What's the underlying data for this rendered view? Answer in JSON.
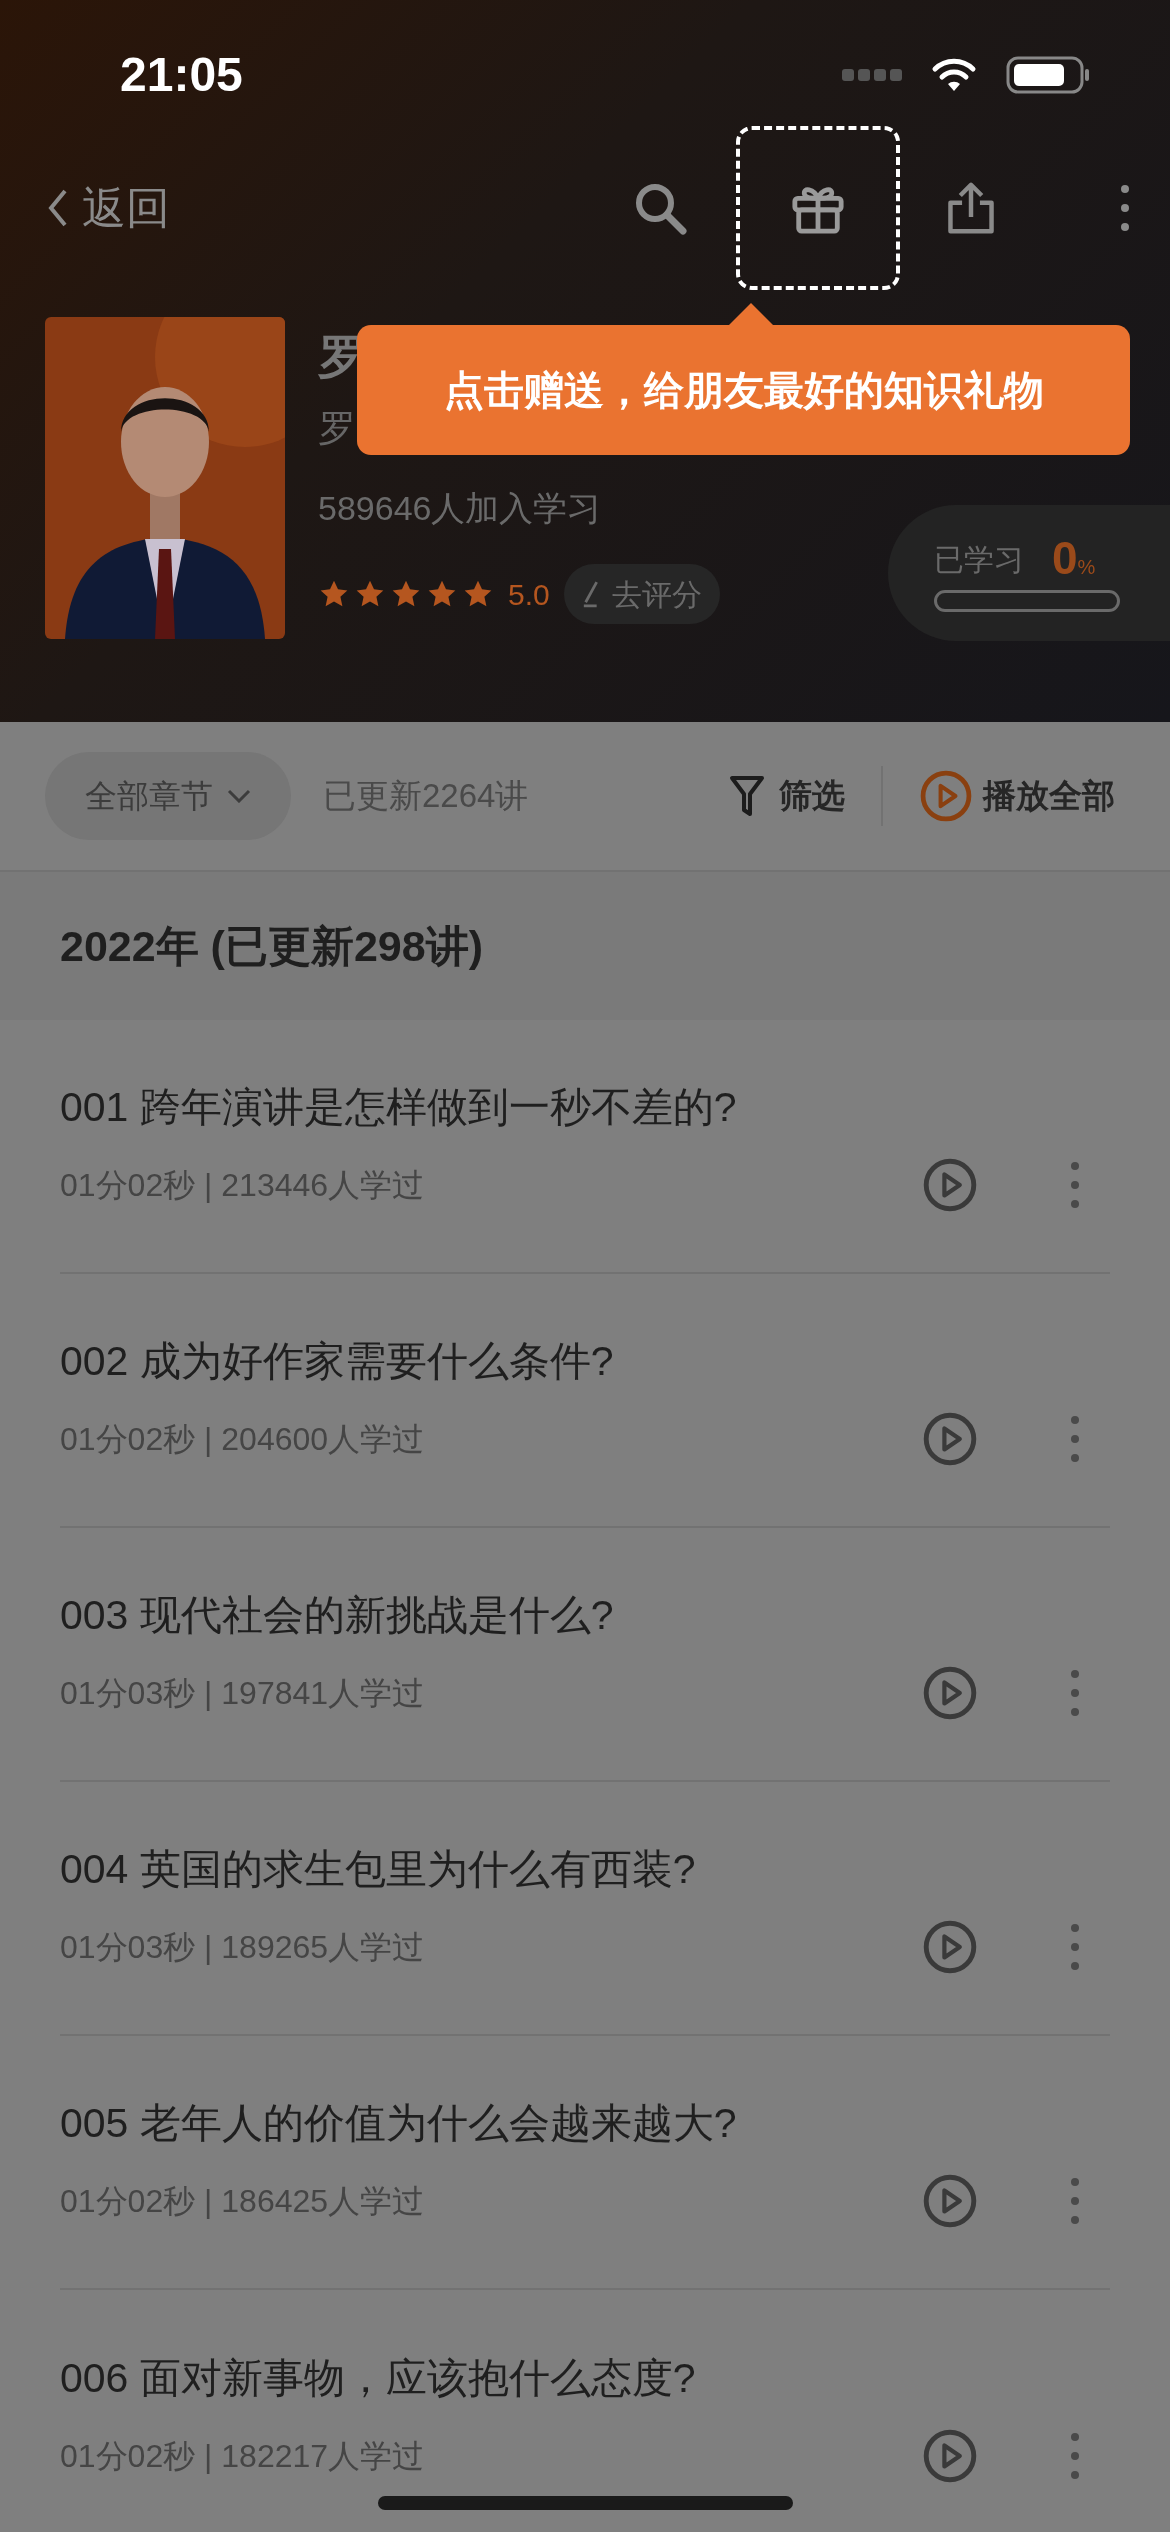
{
  "status_bar": {
    "time": "21:05"
  },
  "nav": {
    "back_label": "返回"
  },
  "tooltip": {
    "text": "点击赠送，给朋友最好的知识礼物"
  },
  "course": {
    "title": "罗",
    "author": "罗",
    "learners": "589646人加入学习",
    "stars": 5,
    "rating": "5.0",
    "rate_button": "去评分"
  },
  "progress": {
    "label": "已学习",
    "percent": "0",
    "unit": "%",
    "level": 0
  },
  "toolbar": {
    "chapter_dropdown": "全部章节",
    "updated": "已更新2264讲",
    "filter": "筛选",
    "play_all": "播放全部"
  },
  "section": {
    "title": "2022年 (已更新298讲)"
  },
  "lessons": [
    {
      "title": "001 跨年演讲是怎样做到一秒不差的?",
      "meta": "01分02秒 | 213446人学过"
    },
    {
      "title": "002 成为好作家需要什么条件?",
      "meta": "01分02秒 | 204600人学过"
    },
    {
      "title": "003 现代社会的新挑战是什么?",
      "meta": "01分03秒 | 197841人学过"
    },
    {
      "title": "004 英国的求生包里为什么有西装?",
      "meta": "01分03秒 | 189265人学过"
    },
    {
      "title": "005 老年人的价值为什么会越来越大?",
      "meta": "01分02秒 | 186425人学过"
    },
    {
      "title": "006 面对新事物，应该抱什么态度?",
      "meta": "01分02秒 | 182217人学过"
    }
  ]
}
